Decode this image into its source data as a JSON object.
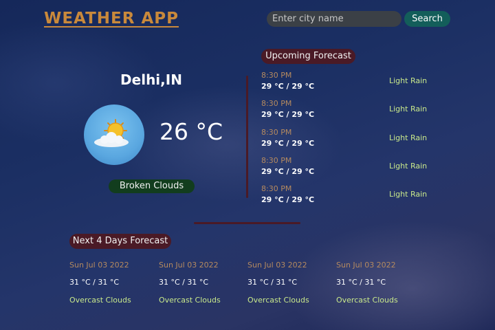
{
  "header": {
    "title": "WEATHER APP",
    "search_placeholder": "Enter city name",
    "search_label": "Search"
  },
  "current": {
    "city": "Delhi,IN",
    "temperature": "26 °C",
    "description": "Broken Clouds",
    "icon": "sun-behind-cloud-icon"
  },
  "upcoming": {
    "label": "Upcoming Forecast",
    "items": [
      {
        "time": "8:30 PM",
        "temp": "29 °C / 29 °C",
        "desc": "Light Rain"
      },
      {
        "time": "8:30 PM",
        "temp": "29 °C / 29 °C",
        "desc": "Light Rain"
      },
      {
        "time": "8:30 PM",
        "temp": "29 °C / 29 °C",
        "desc": "Light Rain"
      },
      {
        "time": "8:30 PM",
        "temp": "29 °C / 29 °C",
        "desc": "Light Rain"
      },
      {
        "time": "8:30 PM",
        "temp": "29 °C / 29 °C",
        "desc": "Light Rain"
      }
    ]
  },
  "next_days": {
    "label": "Next 4 Days Forecast",
    "items": [
      {
        "date": "Sun Jul 03 2022",
        "temp": "31 °C / 31 °C",
        "desc": "Overcast Clouds"
      },
      {
        "date": "Sun Jul 03 2022",
        "temp": "31 °C / 31 °C",
        "desc": "Overcast Clouds"
      },
      {
        "date": "Sun Jul 03 2022",
        "temp": "31 °C / 31 °C",
        "desc": "Overcast Clouds"
      },
      {
        "date": "Sun Jul 03 2022",
        "temp": "31 °C / 31 °C",
        "desc": "Overcast Clouds"
      }
    ]
  },
  "colors": {
    "title": "#c9893b",
    "search_button": "#135e5a",
    "badge_red": "#4a1a26",
    "badge_green": "#123d1e",
    "time_text": "#b58a5f",
    "desc_text": "#c9e98b"
  }
}
